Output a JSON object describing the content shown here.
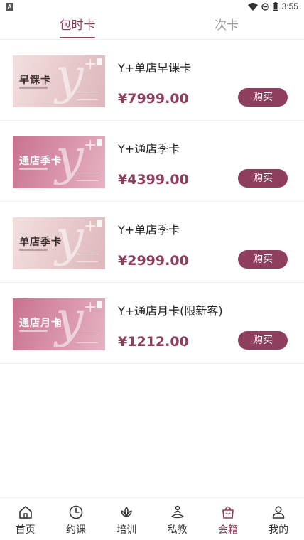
{
  "status_bar": {
    "time": "3:55",
    "notification": "A"
  },
  "tabs": [
    {
      "label": "包时卡",
      "active": true
    },
    {
      "label": "次卡",
      "active": false
    }
  ],
  "cards": [
    {
      "name": "Y+单店早课卡",
      "price": "¥7999.00",
      "button": "购买",
      "thumb_title": "早课卡"
    },
    {
      "name": "Y+通店季卡",
      "price": "¥4399.00",
      "button": "购买",
      "thumb_title": "通店季卡"
    },
    {
      "name": "Y+单店季卡",
      "price": "¥2999.00",
      "button": "购买",
      "thumb_title": "单店季卡"
    },
    {
      "name": "Y+通店月卡(限新客)",
      "price": "¥1212.00",
      "button": "购买",
      "thumb_title": "通店月卡"
    }
  ],
  "bottom_nav": [
    {
      "label": "首页",
      "icon": "home-icon",
      "active": false
    },
    {
      "label": "约课",
      "icon": "clock-icon",
      "active": false
    },
    {
      "label": "培训",
      "icon": "lotus-icon",
      "active": false
    },
    {
      "label": "私教",
      "icon": "meditation-icon",
      "active": false
    },
    {
      "label": "会籍",
      "icon": "shopping-bag-icon",
      "active": true
    },
    {
      "label": "我的",
      "icon": "person-icon",
      "active": false
    }
  ],
  "colors": {
    "accent": "#8e3f5e",
    "inactive_tab": "#9a9a9a"
  }
}
